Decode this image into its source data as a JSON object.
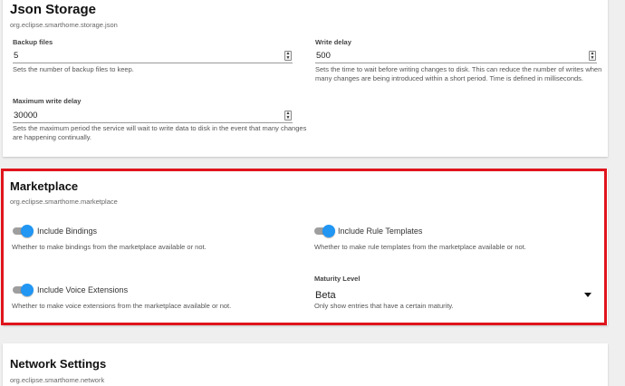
{
  "json_storage": {
    "title": "Json Storage",
    "pid": "org.eclipse.smarthome.storage.json",
    "backup_files": {
      "label": "Backup files",
      "value": "5",
      "help": "Sets the number of backup files to keep."
    },
    "write_delay": {
      "label": "Write delay",
      "value": "500",
      "help_line1": "Sets the time to wait before writing changes to disk. This can reduce the number of writes when",
      "help_line2": "many changes are being introduced within a short period. Time is defined in milliseconds."
    },
    "max_write_delay": {
      "label": "Maximum write delay",
      "value": "30000",
      "help_line1": "Sets the maximum period the service will wait to write data to disk in the event that many changes",
      "help_line2": "are happening continually."
    }
  },
  "marketplace": {
    "title": "Marketplace",
    "pid": "org.eclipse.smarthome.marketplace",
    "include_bindings": {
      "label": "Include Bindings",
      "enabled": true,
      "help": "Whether to make bindings from the marketplace available or not."
    },
    "include_rule_templates": {
      "label": "Include Rule Templates",
      "enabled": true,
      "help": "Whether to make rule templates from the marketplace available or not."
    },
    "include_voice_extensions": {
      "label": "Include Voice Extensions",
      "enabled": true,
      "help": "Whether to make voice extensions from the marketplace available or not."
    },
    "maturity_level": {
      "label": "Maturity Level",
      "value": "Beta",
      "help": "Only show entries that have a certain maturity."
    }
  },
  "network": {
    "title": "Network Settings",
    "pid": "org.eclipse.smarthome.network"
  },
  "colors": {
    "toggle_on": "#2196f3",
    "highlight": "#e0141c",
    "background": "#efefef"
  },
  "icons": {
    "spinner": "spinner-arrows-icon",
    "select": "triangle-down-icon"
  }
}
